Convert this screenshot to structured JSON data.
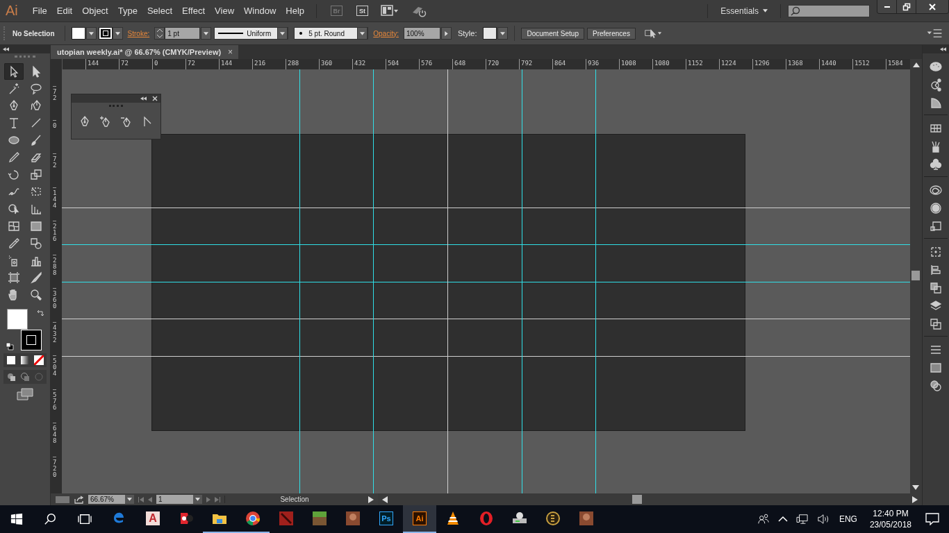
{
  "menu_bar": {
    "logo": "Ai",
    "items": [
      "File",
      "Edit",
      "Object",
      "Type",
      "Select",
      "Effect",
      "View",
      "Window",
      "Help"
    ],
    "bridge_buttons": [
      "Br",
      "St"
    ],
    "workspace": "Essentials"
  },
  "control_bar": {
    "selection": "No Selection",
    "stroke_label": "Stroke:",
    "stroke_weight": "1 pt",
    "profile": "Uniform",
    "brush": "5 pt. Round",
    "opacity_label": "Opacity:",
    "opacity": "100%",
    "style_label": "Style:",
    "buttons": [
      "Document Setup",
      "Preferences"
    ]
  },
  "document_tab": {
    "title": "utopian weekly.ai* @ 66.67% (CMYK/Preview)",
    "close": "×"
  },
  "tools": [
    {
      "kind": "selection",
      "selected": true
    },
    {
      "kind": "direct-selection",
      "selected": false
    },
    {
      "kind": "magic-wand",
      "selected": false
    },
    {
      "kind": "lasso",
      "selected": false
    },
    {
      "kind": "pen",
      "selected": false
    },
    {
      "kind": "curvature",
      "selected": false
    },
    {
      "kind": "type",
      "selected": false
    },
    {
      "kind": "line",
      "selected": false
    },
    {
      "kind": "ellipse",
      "selected": false
    },
    {
      "kind": "paintbrush",
      "selected": false
    },
    {
      "kind": "pencil",
      "selected": false
    },
    {
      "kind": "eraser",
      "selected": false
    },
    {
      "kind": "rotate",
      "selected": false
    },
    {
      "kind": "scale",
      "selected": false
    },
    {
      "kind": "warp",
      "selected": false
    },
    {
      "kind": "free-transform",
      "selected": false
    },
    {
      "kind": "shape-builder",
      "selected": false
    },
    {
      "kind": "perspective-grid",
      "selected": false
    },
    {
      "kind": "mesh",
      "selected": false
    },
    {
      "kind": "gradient",
      "selected": false
    },
    {
      "kind": "eyedropper",
      "selected": false
    },
    {
      "kind": "blend",
      "selected": false
    },
    {
      "kind": "symbol-sprayer",
      "selected": false
    },
    {
      "kind": "column-graph",
      "selected": false
    },
    {
      "kind": "artboard",
      "selected": false
    },
    {
      "kind": "slice",
      "selected": false
    },
    {
      "kind": "hand",
      "selected": false
    },
    {
      "kind": "zoom",
      "selected": false
    }
  ],
  "floating_panel": {
    "tools": [
      {
        "kind": "pen"
      },
      {
        "kind": "add-anchor"
      },
      {
        "kind": "delete-anchor"
      },
      {
        "kind": "anchor-convert"
      }
    ]
  },
  "rulers": {
    "horizontal": [
      "144",
      "72",
      "0",
      "72",
      "144",
      "216",
      "288",
      "360",
      "432",
      "504",
      "576",
      "648",
      "720",
      "792",
      "864",
      "936",
      "1008",
      "1080",
      "1152",
      "1224",
      "1296",
      "1368",
      "1440",
      "1512",
      "1584"
    ],
    "vertical": [
      "72",
      "0",
      "72",
      "144",
      "216",
      "288",
      "360",
      "432",
      "504",
      "576",
      "648",
      "720"
    ]
  },
  "status_bar": {
    "zoom": "66.67%",
    "artboard": "1",
    "tool": "Selection"
  },
  "taskbar": {
    "apps": [
      {
        "kind": "edge",
        "running": false,
        "selected": false
      },
      {
        "kind": "autocad",
        "label": "A",
        "running": false,
        "selected": false
      },
      {
        "kind": "music",
        "running": false,
        "selected": false
      },
      {
        "kind": "folder",
        "running": true,
        "selected": false
      },
      {
        "kind": "chrome",
        "running": true,
        "selected": false
      },
      {
        "kind": "tile",
        "running": false,
        "selected": false
      },
      {
        "kind": "grass-block",
        "running": false,
        "selected": false
      },
      {
        "kind": "picture",
        "running": false,
        "selected": false
      },
      {
        "kind": "photoshop",
        "label": "Ps",
        "running": false,
        "selected": false
      },
      {
        "kind": "illustrator",
        "label": "Ai",
        "running": true,
        "selected": true
      },
      {
        "kind": "cone",
        "running": false,
        "selected": false
      },
      {
        "kind": "opera",
        "running": false,
        "selected": false
      },
      {
        "kind": "drive",
        "running": false,
        "selected": false
      },
      {
        "kind": "coin",
        "running": false,
        "selected": false
      },
      {
        "kind": "picture",
        "running": false,
        "selected": false
      }
    ],
    "language": "ENG",
    "time": "12:40 PM",
    "date": "23/05/2018"
  }
}
